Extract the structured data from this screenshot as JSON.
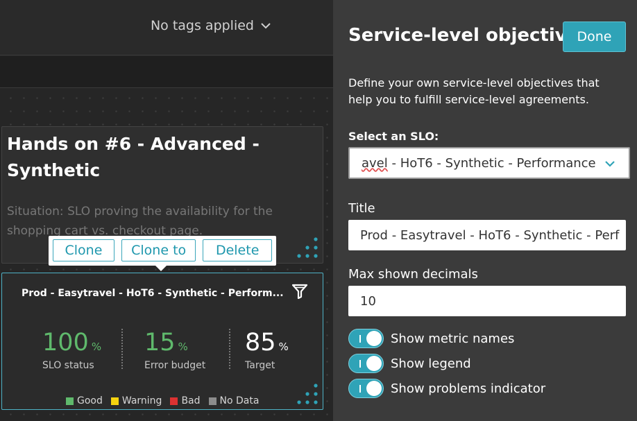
{
  "header": {
    "tags_label": "No tags applied"
  },
  "markdown_tile": {
    "title": "Hands on #6 - Advanced - Synthetic",
    "text": "Situation: SLO proving the availability for the shopping cart vs. checkout page."
  },
  "context_menu": {
    "clone": "Clone",
    "clone_to": "Clone to",
    "delete": "Delete"
  },
  "slo_tile": {
    "name": "Prod - Easytravel - HoT6 - Synthetic - Perform...",
    "metrics": [
      {
        "value": "100",
        "unit": "%",
        "label": "SLO status",
        "color": "#5fb96c"
      },
      {
        "value": "15",
        "unit": "%",
        "label": "Error budget",
        "color": "#5fb96c"
      },
      {
        "value": "85",
        "unit": "%",
        "label": "Target",
        "color": "#ffffff"
      }
    ],
    "legend": [
      {
        "label": "Good",
        "color": "#5fb96c"
      },
      {
        "label": "Warning",
        "color": "#f5d30f"
      },
      {
        "label": "Bad",
        "color": "#dc3232"
      },
      {
        "label": "No Data",
        "color": "#8c8c8c"
      }
    ]
  },
  "panel": {
    "title": "Service-level objective",
    "done": "Done",
    "description": "Define your own service-level objectives that help you to fulfill service-level agreements.",
    "select_label": "Select an SLO:",
    "select_value_prefix": "avel",
    "select_value_rest": " - HoT6 - Synthetic - Performance",
    "title_label": "Title",
    "title_value": "Prod - Easytravel - HoT6 - Synthetic - Perf",
    "decimals_label": "Max shown decimals",
    "decimals_value": "10",
    "toggles": [
      {
        "label": "Show metric names",
        "on": true
      },
      {
        "label": "Show legend",
        "on": true
      },
      {
        "label": "Show problems indicator",
        "on": true
      }
    ]
  },
  "colors": {
    "accent": "#2fa3b7",
    "tile_border_selected": "#4fb3c7"
  }
}
